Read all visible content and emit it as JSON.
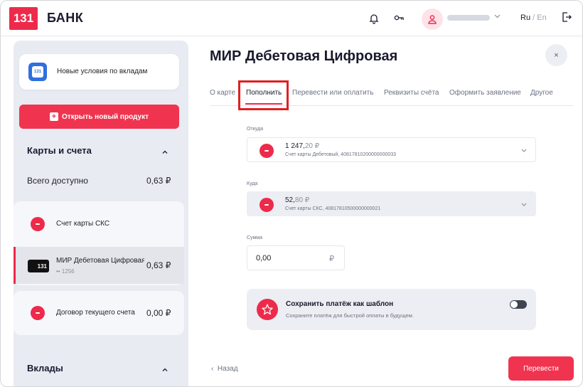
{
  "header": {
    "logo_number": "131",
    "logo_text": "БАНК",
    "lang_ru": "Ru",
    "lang_sep": " / ",
    "lang_en": "En"
  },
  "sidebar": {
    "news_text": "Новые условия по вкладам",
    "news_icon_text": "131",
    "open_product_label": "Открыть новый продукт",
    "cards_section_title": "Карты и счета",
    "total_label": "Всего доступно",
    "total_value": "0,63 ₽",
    "accounts": [
      {
        "name": "Счет карты СКС",
        "sub": "",
        "amount": ""
      },
      {
        "name": "МИР Дебетовая Цифровая",
        "sub": "•• 1256",
        "amount": "0,63 ₽",
        "card_text": "131"
      },
      {
        "name": "Договор текущего счета",
        "sub": "",
        "amount": "0,00 ₽"
      }
    ],
    "deposits_section_title": "Вклады"
  },
  "main": {
    "title": "МИР Дебетовая Цифровая",
    "close_label": "×",
    "tabs": [
      {
        "label": "О карте"
      },
      {
        "label": "Пополнить"
      },
      {
        "label": "Перевести или оплатить"
      },
      {
        "label": "Реквизиты счёта"
      },
      {
        "label": "Оформить заявление"
      },
      {
        "label": "Другое"
      }
    ],
    "from": {
      "label": "Откуда",
      "amount_int": "1 247,",
      "amount_dec": "20 ₽",
      "sub": "Счет карты Дебетовый, 40817810200000000033"
    },
    "to": {
      "label": "Куда",
      "amount_int": "52,",
      "amount_dec": "80 ₽",
      "sub": "Счет карты СКС, 40817810500000000021"
    },
    "sum": {
      "label": "Сумма",
      "value": "0,00",
      "currency": "₽"
    },
    "template": {
      "title": "Сохранить платёж как шаблон",
      "subtitle": "Сохраните платёж для быстрой оплаты в будущем."
    },
    "back_label": "Назад",
    "back_icon": "‹",
    "submit_label": "Перевести"
  },
  "colors": {
    "brand": "#ee2a4a",
    "sidebar_bg": "#e8ebf2",
    "highlight": "#e02020"
  }
}
